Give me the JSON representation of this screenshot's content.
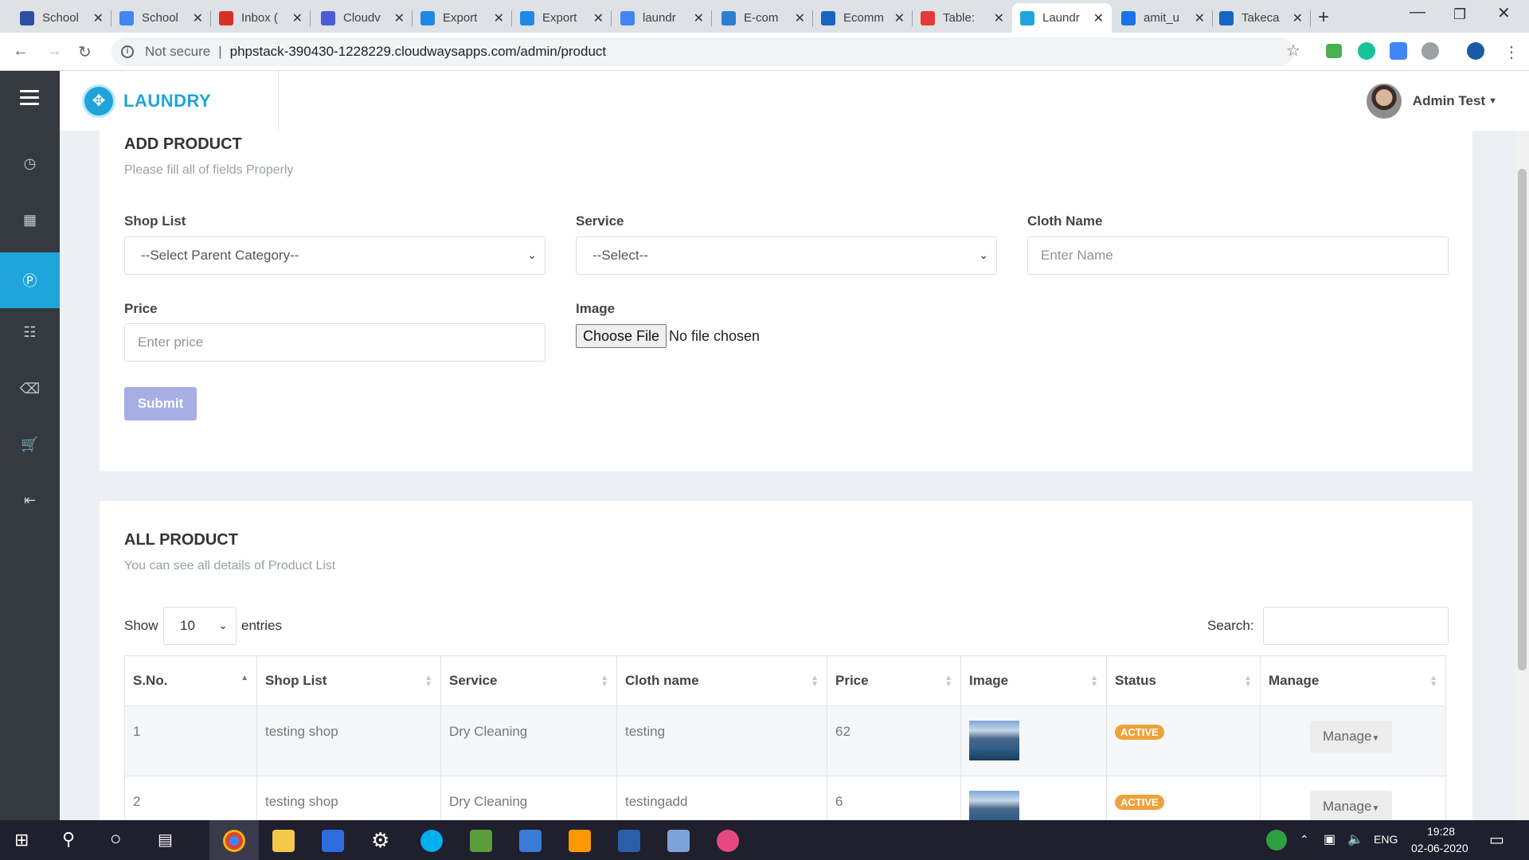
{
  "browser": {
    "tabs": [
      {
        "title": "School",
        "color": "#2d4ea3"
      },
      {
        "title": "School",
        "color": "#4285f4"
      },
      {
        "title": "Inbox (",
        "color": "#d93025"
      },
      {
        "title": "Cloudv",
        "color": "#4a5bd4"
      },
      {
        "title": "Export",
        "color": "#1e88e5"
      },
      {
        "title": "Export",
        "color": "#1e88e5"
      },
      {
        "title": "laundr",
        "color": "#4285f4"
      },
      {
        "title": "E-com",
        "color": "#2d7dd2"
      },
      {
        "title": "Ecomm",
        "color": "#1565c0"
      },
      {
        "title": "Table:",
        "color": "#e53935"
      },
      {
        "title": "Laundr",
        "color": "#1fa4dc"
      },
      {
        "title": "amit_u",
        "color": "#1a73e8"
      },
      {
        "title": "Takeca",
        "color": "#1565c0"
      }
    ],
    "active_tab_index": 10,
    "not_secure": "Not secure",
    "url": "phpstack-390430-1228229.cloudwaysapps.com/admin/product"
  },
  "app": {
    "brand": "LAUNDRY",
    "user_name": "Admin Test"
  },
  "add_product": {
    "title": "ADD PRODUCT",
    "subtitle": "Please fill all of fields Properly",
    "shop_label": "Shop List",
    "shop_value": "--Select Parent Category--",
    "service_label": "Service",
    "service_value": "--Select--",
    "cloth_label": "Cloth Name",
    "cloth_placeholder": "Enter Name",
    "price_label": "Price",
    "price_placeholder": "Enter price",
    "image_label": "Image",
    "choose_file": "Choose File",
    "no_file": "No file chosen",
    "submit": "Submit"
  },
  "all_product": {
    "title": "ALL PRODUCT",
    "subtitle": "You can see all details of Product List",
    "show": "Show",
    "entries_value": "10",
    "entries": "entries",
    "search": "Search:",
    "columns": [
      "S.No.",
      "Shop List",
      "Service",
      "Cloth name",
      "Price",
      "Image",
      "Status",
      "Manage"
    ],
    "rows": [
      {
        "sno": "1",
        "shop": "testing shop",
        "service": "Dry Cleaning",
        "cloth": "testing",
        "price": "62",
        "status": "ACTIVE",
        "manage": "Manage"
      },
      {
        "sno": "2",
        "shop": "testing shop",
        "service": "Dry Cleaning",
        "cloth": "testingadd",
        "price": "6",
        "status": "ACTIVE",
        "manage": "Manage"
      }
    ]
  },
  "taskbar": {
    "lang": "ENG",
    "time": "19:28",
    "date": "02-06-2020"
  }
}
